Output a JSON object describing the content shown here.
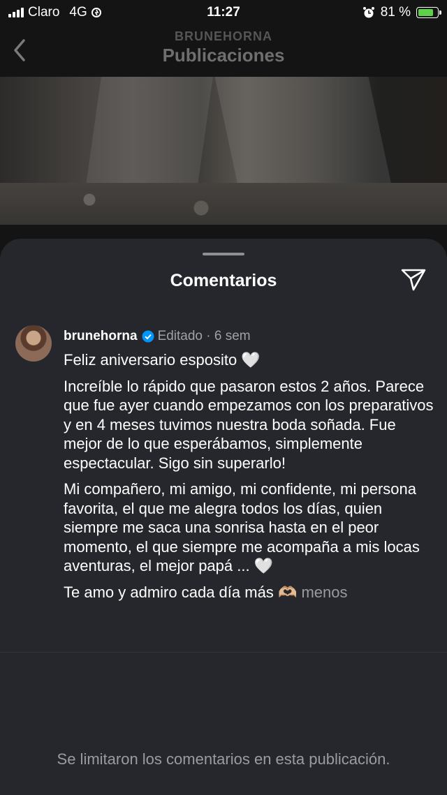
{
  "status_bar": {
    "carrier": "Claro",
    "network": "4G",
    "time": "11:27",
    "battery_percent": "81 %",
    "battery_level": 0.81
  },
  "header": {
    "username": "BRUNEHORNA",
    "title": "Publicaciones"
  },
  "sheet": {
    "title": "Comentarios"
  },
  "comment": {
    "username": "brunehorna",
    "meta": "Editado · 6 sem",
    "line1": "Feliz aniversario esposito",
    "heart1": "🤍",
    "paragraph2": "Increíble lo rápido que pasaron estos 2 años. Parece que fue ayer cuando empezamos con los preparativos y en 4 meses tuvimos nuestra boda soñada. Fue mejor de lo que esperábamos, simplemente espectacular. Sigo sin superarlo!",
    "paragraph3": "Mi compañero, mi amigo, mi confidente, mi persona favorita, el que me alegra todos los días, quien siempre me saca una sonrisa hasta en el peor momento, el que siempre me acompaña a mis locas aventuras, el mejor papá ...",
    "heart2": "🤍",
    "last_line": "Te amo y admiro cada día más",
    "last_emoji": "🫶🏼",
    "less_label": "menos"
  },
  "footer": {
    "limited_text": "Se limitaron los comentarios en esta publicación."
  },
  "colors": {
    "sheet_background": "#25272c",
    "verified_badge": "#0095f6",
    "battery_fill": "#5ed14a"
  }
}
